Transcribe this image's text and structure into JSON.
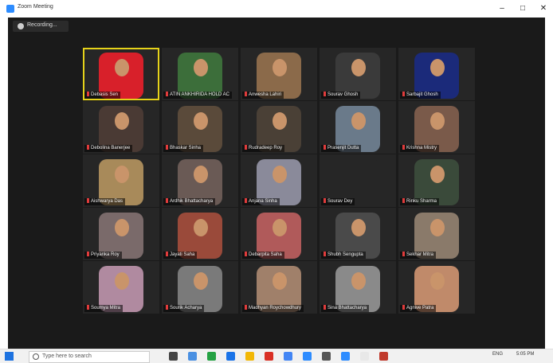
{
  "window": {
    "title": "Zoom Meeting",
    "minimize": "–",
    "maximize": "□",
    "close": "✕"
  },
  "recording": {
    "label": "Recording...",
    "icon": "record-icon"
  },
  "participants": [
    {
      "name": "Debasis Sen",
      "bg": "#d8202a",
      "active": true
    },
    {
      "name": "ATIN ANKHIRIDA HOLD AC",
      "bg": "#3c6e3a"
    },
    {
      "name": "Anwesha Lahiri",
      "bg": "#8b6a4a"
    },
    {
      "name": "Sourav Ghosh",
      "bg": "#3a3a3a"
    },
    {
      "name": "Sarbajit Ghosh",
      "bg": "#1b2a7a"
    },
    {
      "name": "Debolina Banerjee",
      "bg": "#4a3a34"
    },
    {
      "name": "Bhaskar Sinha",
      "bg": "#5a4a3a"
    },
    {
      "name": "Rudradeep Roy",
      "bg": "#4a4036"
    },
    {
      "name": "Prasenjit Dutta",
      "bg": "#6a7a8a"
    },
    {
      "name": "Krishna Mistry",
      "bg": "#7a5a4a"
    },
    {
      "name": "Aishwarya Das",
      "bg": "#a88a5a"
    },
    {
      "name": "Ardhik Bhattacharya",
      "bg": "#6a5a55"
    },
    {
      "name": "Anjana Sinha",
      "bg": "#8a8a9a"
    },
    {
      "name": "Sourav Dey",
      "bg": "#262626"
    },
    {
      "name": "Rinku Sharma",
      "bg": "#3a4a3a"
    },
    {
      "name": "Priyanka Roy",
      "bg": "#7a6a6a"
    },
    {
      "name": "Jayati Saha",
      "bg": "#9a4a3a"
    },
    {
      "name": "Debarpita Saha",
      "bg": "#b05a5a"
    },
    {
      "name": "Shubh Sengupta",
      "bg": "#4a4a4a"
    },
    {
      "name": "Sekhar Mitra",
      "bg": "#8a7a6a"
    },
    {
      "name": "Soumya Mitra",
      "bg": "#b08aa0"
    },
    {
      "name": "Sourik Acharya",
      "bg": "#7a7a7a"
    },
    {
      "name": "Madhyan Roychowdhury",
      "bg": "#a0806a"
    },
    {
      "name": "Sina Bhattacharya",
      "bg": "#8a8a8a"
    },
    {
      "name": "Agnive Patra",
      "bg": "#c08a6a"
    }
  ],
  "taskbar": {
    "search_placeholder": "Type here to search",
    "lang": "ENG",
    "clock": "5:05 PM",
    "app_colors": [
      "#444444",
      "#4a90e2",
      "#25a244",
      "#1a73e8",
      "#f2b705",
      "#d93025",
      "#4285f4",
      "#2d8cff",
      "#555555",
      "#2d8cff",
      "#e8e8e8",
      "#c0392b"
    ]
  }
}
